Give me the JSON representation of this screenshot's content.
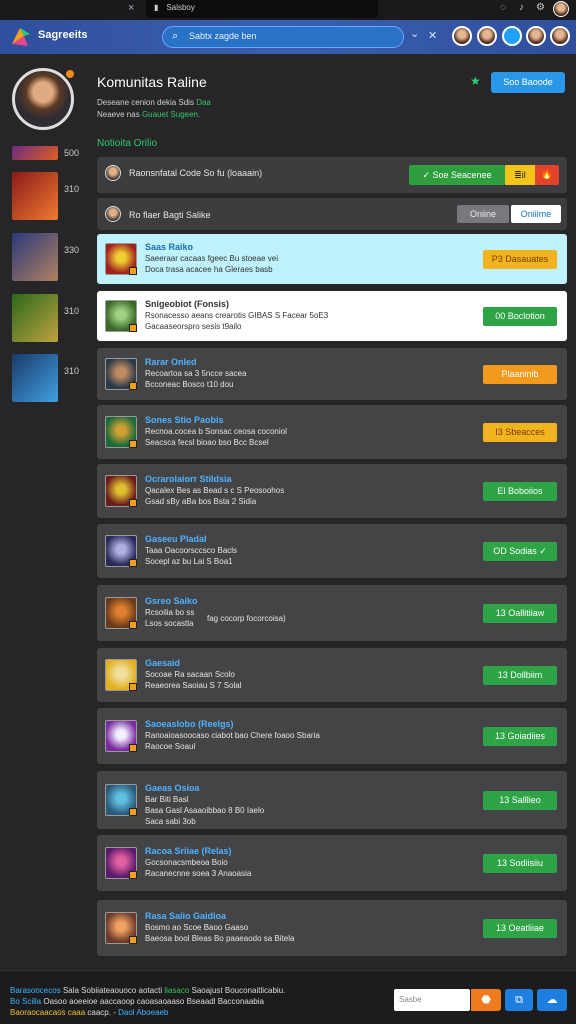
{
  "browser": {
    "tab_title": "Salsboy",
    "close": "×"
  },
  "header": {
    "brand": "Sagreeits",
    "search_placeholder": "Sabtx zagde ben",
    "chevron": "⌄",
    "clear": "✕"
  },
  "profile": {
    "name": "Komunitas Raline",
    "line1": "Deseane cenion dekia Sdis",
    "line1_accent": "Daa",
    "line2": "Neaeve nas",
    "line2_accent": "Guauet Sugeen.",
    "join_button": "Soo Baoode"
  },
  "sidebar": {
    "items": [
      {
        "count": "500",
        "colors": [
          "#6a2a80",
          "#e06020"
        ]
      },
      {
        "count": "310",
        "colors": [
          "#8a1a1a",
          "#f07a30"
        ]
      },
      {
        "count": "330",
        "colors": [
          "#2a3a7a",
          "#b08060"
        ]
      },
      {
        "count": "310",
        "colors": [
          "#2a6a1a",
          "#c0a040"
        ]
      },
      {
        "count": "310",
        "colors": [
          "#1a3a6a",
          "#40a0e0"
        ]
      }
    ]
  },
  "section": {
    "title": "Notioita Orilio"
  },
  "notification_bar": {
    "text": "Raonsnfatal Code So fu (loaaain)",
    "accept": "✓ Soe Seacenee",
    "flag": "≣il",
    "bell": "🔥"
  },
  "status_bar": {
    "text": "Ro flaer Bagti Salike",
    "online_btn": "Oniine",
    "online_btn2": "Oniiime"
  },
  "cards": [
    {
      "title": "Saas Raiko",
      "l1": "Saeeraar cacaas fgeec Bu stoeae vei",
      "l2": "Doca trasa acacee ha Gleraes basb",
      "btn": "P3 Dasauates",
      "style": "bg-yellow",
      "bg": "#bff2fc",
      "colors": [
        "#a02020",
        "#f0d030"
      ]
    },
    {
      "title": "Snigeobiot (Fonsis)",
      "l1": "Rsonacesso aeans crearotis GIBAS S Facear 5oE3",
      "l2": "Gacaaseorspro sesis t9ailo",
      "btn": "00 Boclotion",
      "style": "bg-green",
      "bg": "#ffffff",
      "colors": [
        "#3a6a2a",
        "#a0d080"
      ]
    },
    {
      "title": "Rarar Onled",
      "l1": "Recoartoa sa 3 5ncce sacea",
      "l2": "Bcconeac Bosco t10 dou",
      "btn": "Plaaninib",
      "style": "bg-orange",
      "bg": "#444447",
      "colors": [
        "#2a3a4a",
        "#c08a60"
      ]
    },
    {
      "title": "Sones Stio  Paobis",
      "l1": "Recnoa.cocea b Sonsac ceosa coconiol",
      "l2": "Seacsca fecsl bioao bso Bcc Bcsel",
      "btn": "I3 Sbeacces",
      "style": "bg-yellow",
      "bg": "#444447",
      "colors": [
        "#1a6a3a",
        "#d0a030"
      ]
    },
    {
      "title": "Ocrarolaiorr  Stildsia",
      "l1": "Qacalex Bes as Bead s c S Peosoohos",
      "l2": "Gsad sBy aBa bos Bsta 2 Sidia",
      "btn": "El Boboiios",
      "style": "bg-green",
      "bg": "#444447",
      "colors": [
        "#6a1a1a",
        "#e0c030"
      ]
    },
    {
      "title": "Gaseeu Pladal",
      "l1": "Taaa Oacoorsccsco Bacls",
      "l2": "Socepl az bu Lai S Boa1",
      "btn": "OD Sodias ✓",
      "style": "bg-green",
      "bg": "#444447",
      "colors": [
        "#2a2a5a",
        "#b0b0e0"
      ]
    },
    {
      "title": "Gsreo Saiko",
      "l1": "Rcsoilia bo ss",
      "l1b": "fag cocorp focorcoisa)",
      "l2": "Lsos socastla",
      "btn": "13 Oallitiiaw",
      "style": "bg-green",
      "bg": "#444447",
      "colors": [
        "#6a3a1a",
        "#e08030"
      ]
    },
    {
      "title": "Gaesaid",
      "l1": "Socoae Ra sacaan Scolo",
      "l2": "Reaeorea Saoiau S 7 Solal",
      "btn": "13 Dollbiim",
      "style": "bg-green",
      "bg": "#444447",
      "colors": [
        "#e0b020",
        "#f0e0a0"
      ]
    },
    {
      "title": "Saoeaslobo  (Reelgs)",
      "l1": "Ranoaioasoocaso ciabot bao Chere foaoo Sbaria",
      "l2": "Raocoe Soaul",
      "btn": "13 Goiadiies",
      "style": "bg-green",
      "bg": "#444447",
      "colors": [
        "#7a2aa0",
        "#f0f0ff"
      ]
    },
    {
      "title": "Gaeas Osioa",
      "l1": "Bar Biti Basl",
      "l2": "Basa Gasl Asaaoibbao 8 B0 Iaelo",
      "l3": "Saca sabi 3ob",
      "btn": "13 Salllieo",
      "style": "bg-green",
      "bg": "#444447",
      "colors": [
        "#2a5a7a",
        "#60c0e0"
      ]
    },
    {
      "title": "Racoa Sriiae  (Relas)",
      "l1": "Gocsonacsmbeoa Boio",
      "l2": "Racanecnne soea 3 Anaoasia",
      "btn": "13 Sodiisiiu",
      "style": "bg-green",
      "bg": "#444447",
      "colors": [
        "#5a1a6a",
        "#e060a0"
      ]
    },
    {
      "title": "Rasa Saiio  Gaidioa",
      "l1": "Bosmo ao Scoe Baoo Gaaso",
      "l2": "Baeosa bool Bleas Bo paaeaodo sa Bitela",
      "btn": "13 Oeatliiae",
      "style": "bg-green",
      "bg": "#444447",
      "colors": [
        "#6a3a2a",
        "#f0a060"
      ]
    }
  ],
  "footer": {
    "line1_a": "Barasoocecos",
    "line1_b": "Sala Sobiiateaouoco aotacti",
    "line1_c": "liasaco",
    "line1_d": "Saoajust Bouconaitlicabiu.",
    "line2_a": "Bo Scilla",
    "line2_b": "Oasoo aoeeioe aaccaoop caoasaoaaso Bseaadl Bacconaabia",
    "line3_a": "Baoraocaacaos caaa",
    "line3_b": "caacp. -",
    "line3_c": "Daol Aboeaeb",
    "input_placeholder": "Sasbe",
    "btn1": "⬣",
    "btn2": "⧉",
    "btn3": "☁"
  },
  "colors": {
    "accent": "#2a96e8",
    "green": "#2ea446",
    "header": "#3a5fb0"
  }
}
